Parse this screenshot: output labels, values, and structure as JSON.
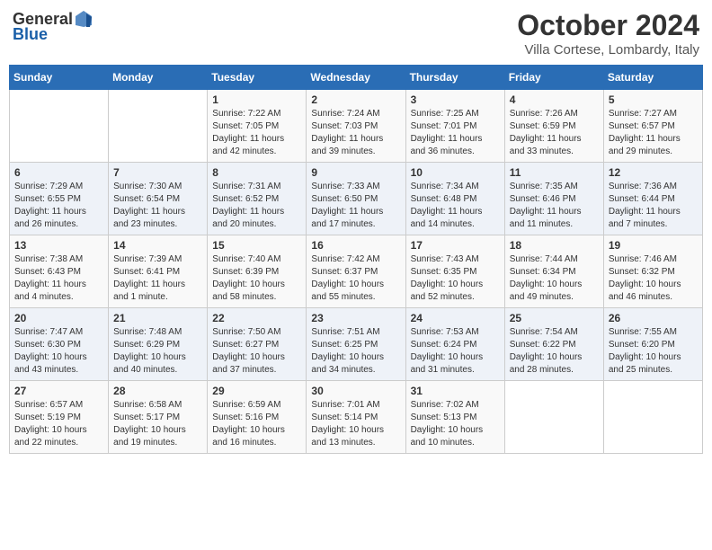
{
  "header": {
    "logo_general": "General",
    "logo_blue": "Blue",
    "month_title": "October 2024",
    "location": "Villa Cortese, Lombardy, Italy"
  },
  "weekdays": [
    "Sunday",
    "Monday",
    "Tuesday",
    "Wednesday",
    "Thursday",
    "Friday",
    "Saturday"
  ],
  "weeks": [
    [
      {
        "day": "",
        "info": ""
      },
      {
        "day": "",
        "info": ""
      },
      {
        "day": "1",
        "info": "Sunrise: 7:22 AM\nSunset: 7:05 PM\nDaylight: 11 hours and 42 minutes."
      },
      {
        "day": "2",
        "info": "Sunrise: 7:24 AM\nSunset: 7:03 PM\nDaylight: 11 hours and 39 minutes."
      },
      {
        "day": "3",
        "info": "Sunrise: 7:25 AM\nSunset: 7:01 PM\nDaylight: 11 hours and 36 minutes."
      },
      {
        "day": "4",
        "info": "Sunrise: 7:26 AM\nSunset: 6:59 PM\nDaylight: 11 hours and 33 minutes."
      },
      {
        "day": "5",
        "info": "Sunrise: 7:27 AM\nSunset: 6:57 PM\nDaylight: 11 hours and 29 minutes."
      }
    ],
    [
      {
        "day": "6",
        "info": "Sunrise: 7:29 AM\nSunset: 6:55 PM\nDaylight: 11 hours and 26 minutes."
      },
      {
        "day": "7",
        "info": "Sunrise: 7:30 AM\nSunset: 6:54 PM\nDaylight: 11 hours and 23 minutes."
      },
      {
        "day": "8",
        "info": "Sunrise: 7:31 AM\nSunset: 6:52 PM\nDaylight: 11 hours and 20 minutes."
      },
      {
        "day": "9",
        "info": "Sunrise: 7:33 AM\nSunset: 6:50 PM\nDaylight: 11 hours and 17 minutes."
      },
      {
        "day": "10",
        "info": "Sunrise: 7:34 AM\nSunset: 6:48 PM\nDaylight: 11 hours and 14 minutes."
      },
      {
        "day": "11",
        "info": "Sunrise: 7:35 AM\nSunset: 6:46 PM\nDaylight: 11 hours and 11 minutes."
      },
      {
        "day": "12",
        "info": "Sunrise: 7:36 AM\nSunset: 6:44 PM\nDaylight: 11 hours and 7 minutes."
      }
    ],
    [
      {
        "day": "13",
        "info": "Sunrise: 7:38 AM\nSunset: 6:43 PM\nDaylight: 11 hours and 4 minutes."
      },
      {
        "day": "14",
        "info": "Sunrise: 7:39 AM\nSunset: 6:41 PM\nDaylight: 11 hours and 1 minute."
      },
      {
        "day": "15",
        "info": "Sunrise: 7:40 AM\nSunset: 6:39 PM\nDaylight: 10 hours and 58 minutes."
      },
      {
        "day": "16",
        "info": "Sunrise: 7:42 AM\nSunset: 6:37 PM\nDaylight: 10 hours and 55 minutes."
      },
      {
        "day": "17",
        "info": "Sunrise: 7:43 AM\nSunset: 6:35 PM\nDaylight: 10 hours and 52 minutes."
      },
      {
        "day": "18",
        "info": "Sunrise: 7:44 AM\nSunset: 6:34 PM\nDaylight: 10 hours and 49 minutes."
      },
      {
        "day": "19",
        "info": "Sunrise: 7:46 AM\nSunset: 6:32 PM\nDaylight: 10 hours and 46 minutes."
      }
    ],
    [
      {
        "day": "20",
        "info": "Sunrise: 7:47 AM\nSunset: 6:30 PM\nDaylight: 10 hours and 43 minutes."
      },
      {
        "day": "21",
        "info": "Sunrise: 7:48 AM\nSunset: 6:29 PM\nDaylight: 10 hours and 40 minutes."
      },
      {
        "day": "22",
        "info": "Sunrise: 7:50 AM\nSunset: 6:27 PM\nDaylight: 10 hours and 37 minutes."
      },
      {
        "day": "23",
        "info": "Sunrise: 7:51 AM\nSunset: 6:25 PM\nDaylight: 10 hours and 34 minutes."
      },
      {
        "day": "24",
        "info": "Sunrise: 7:53 AM\nSunset: 6:24 PM\nDaylight: 10 hours and 31 minutes."
      },
      {
        "day": "25",
        "info": "Sunrise: 7:54 AM\nSunset: 6:22 PM\nDaylight: 10 hours and 28 minutes."
      },
      {
        "day": "26",
        "info": "Sunrise: 7:55 AM\nSunset: 6:20 PM\nDaylight: 10 hours and 25 minutes."
      }
    ],
    [
      {
        "day": "27",
        "info": "Sunrise: 6:57 AM\nSunset: 5:19 PM\nDaylight: 10 hours and 22 minutes."
      },
      {
        "day": "28",
        "info": "Sunrise: 6:58 AM\nSunset: 5:17 PM\nDaylight: 10 hours and 19 minutes."
      },
      {
        "day": "29",
        "info": "Sunrise: 6:59 AM\nSunset: 5:16 PM\nDaylight: 10 hours and 16 minutes."
      },
      {
        "day": "30",
        "info": "Sunrise: 7:01 AM\nSunset: 5:14 PM\nDaylight: 10 hours and 13 minutes."
      },
      {
        "day": "31",
        "info": "Sunrise: 7:02 AM\nSunset: 5:13 PM\nDaylight: 10 hours and 10 minutes."
      },
      {
        "day": "",
        "info": ""
      },
      {
        "day": "",
        "info": ""
      }
    ]
  ]
}
